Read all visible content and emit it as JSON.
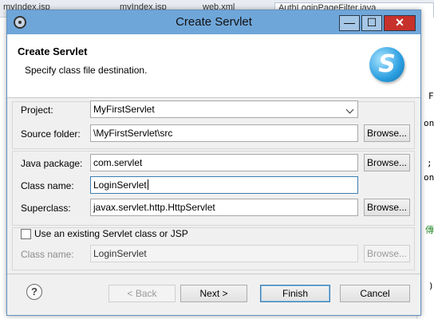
{
  "background": {
    "tabs": [
      "myIndex.jsp",
      "myIndex.jsp",
      "web.xml",
      "AuthLoginPageFilter.java"
    ],
    "code_fragments": [
      "F",
      "on",
      ";",
      "on",
      "傳",
      ")"
    ]
  },
  "window": {
    "title": "Create Servlet",
    "controls": {
      "minimize": "—",
      "maximize": "☐",
      "close": "✕"
    }
  },
  "header": {
    "title": "Create Servlet",
    "subtitle": "Specify class file destination.",
    "logo_letter": "S"
  },
  "form": {
    "project": {
      "label": "Project:",
      "value": "MyFirstServlet"
    },
    "source_folder": {
      "label": "Source folder:",
      "value": "\\MyFirstServlet\\src",
      "browse": "Browse..."
    },
    "java_package": {
      "label": "Java package:",
      "value": "com.servlet",
      "browse": "Browse..."
    },
    "class_name": {
      "label": "Class name:",
      "value": "LoginServlet"
    },
    "superclass": {
      "label": "Superclass:",
      "value": "javax.servlet.http.HttpServlet",
      "browse": "Browse..."
    },
    "use_existing": {
      "label": "Use an existing Servlet class or JSP",
      "checked": false
    },
    "existing_class_name": {
      "label": "Class name:",
      "value": "LoginServlet",
      "browse": "Browse..."
    }
  },
  "footer": {
    "help": "?",
    "back": "< Back",
    "next": "Next >",
    "finish": "Finish",
    "cancel": "Cancel"
  },
  "colors": {
    "titlebar": "#6fa6d9",
    "close_button": "#c7312b",
    "accent": "#3c7fb1"
  }
}
